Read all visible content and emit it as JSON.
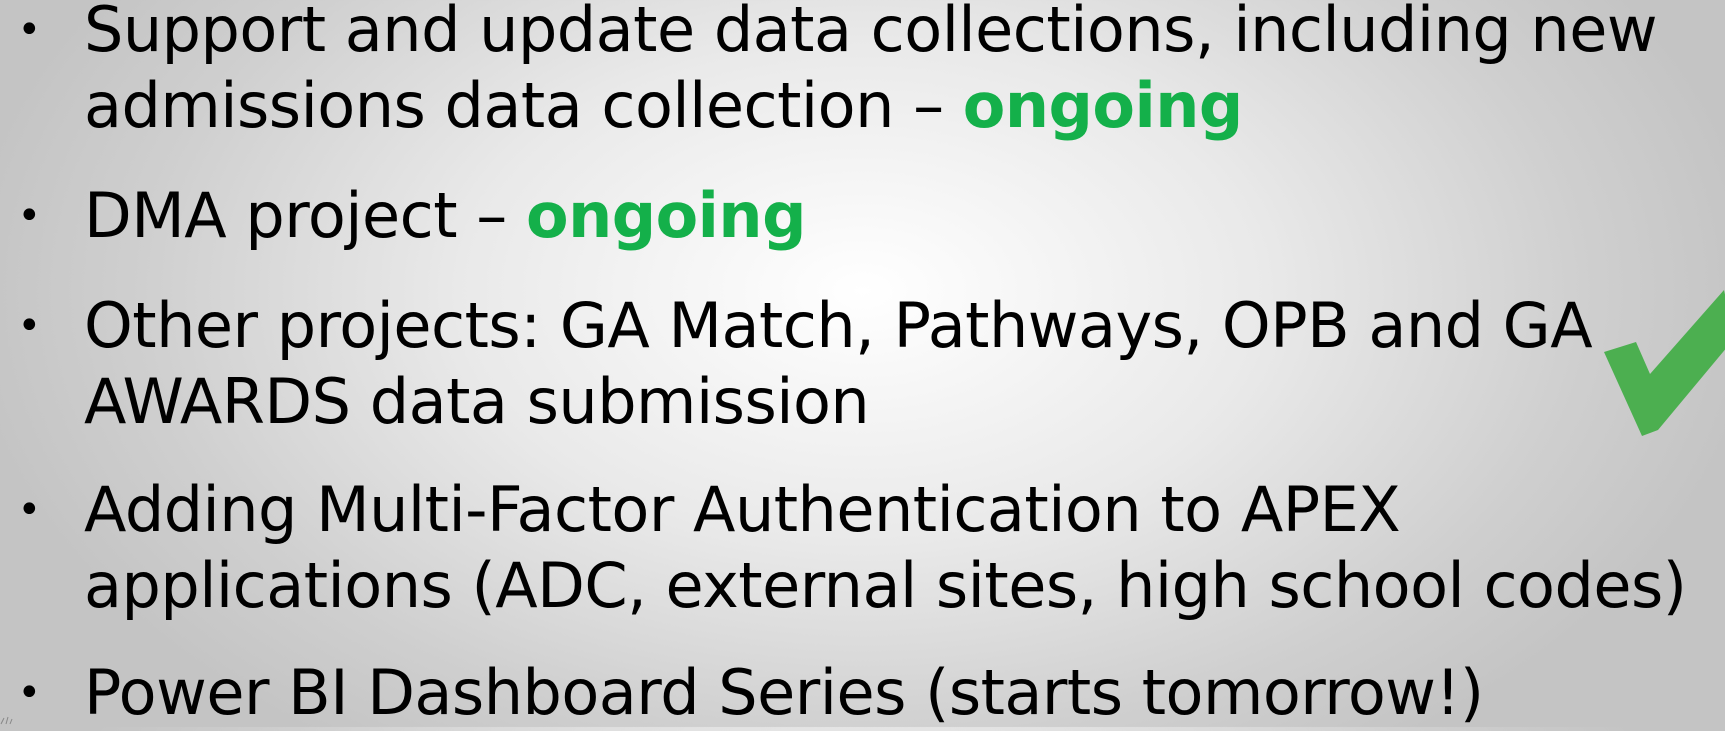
{
  "bullets": [
    {
      "id": "item-1",
      "line1": "Support and update data collections, including new",
      "line2": "admissions data collection – ",
      "status": "ongoing"
    },
    {
      "id": "item-2",
      "line1": "DMA project – ",
      "status": "ongoing"
    },
    {
      "id": "item-3",
      "line1": "Other projects: GA Match, Pathways, OPB and GA",
      "line2": "AWARDS data submission"
    },
    {
      "id": "item-4",
      "line1": "Adding Multi-Factor Authentication to APEX",
      "line2": "applications (ADC, external sites, high school codes)"
    },
    {
      "id": "item-5",
      "line1": "Power BI Dashboard Series (starts tomorrow!)"
    }
  ],
  "bullet_char": "•",
  "icons": {
    "check": "checkmark-icon"
  },
  "colors": {
    "status": "#14b04a",
    "check": "#4caf50",
    "text": "#000000"
  }
}
